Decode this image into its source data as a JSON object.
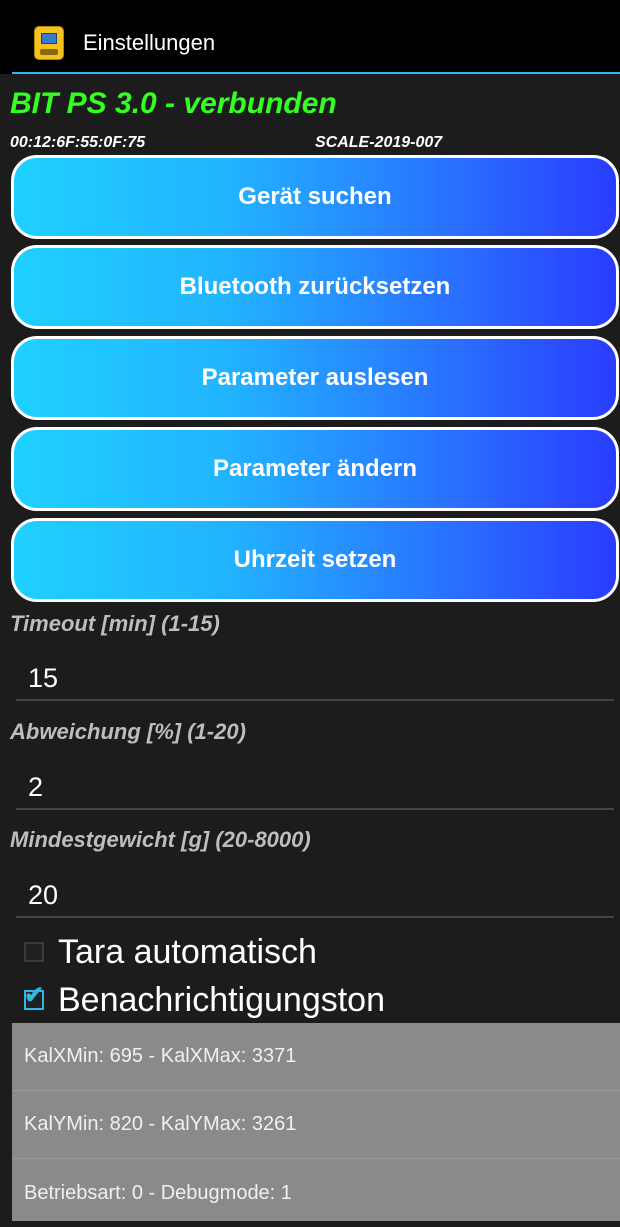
{
  "titlebar": {
    "title": "Einstellungen",
    "icon": "scale-app-icon"
  },
  "status": {
    "connection": "BIT PS 3.0 - verbunden",
    "mac_address": "00:12:6F:55:0F:75",
    "device_id": "SCALE-2019-007"
  },
  "buttons": {
    "search": "Gerät suchen",
    "reset_bluetooth": "Bluetooth zurücksetzen",
    "read_params": "Parameter auslesen",
    "change_params": "Parameter ändern",
    "set_time": "Uhrzeit setzen"
  },
  "fields": {
    "timeout": {
      "label": "Timeout [min] (1-15)",
      "value": "15"
    },
    "deviation": {
      "label": "Abweichung [%] (1-20)",
      "value": "2"
    },
    "min_weight": {
      "label": "Mindestgewicht [g] (20-8000)",
      "value": "20"
    }
  },
  "checkboxes": {
    "tare_auto": {
      "label": "Tara automatisch",
      "checked": false
    },
    "notify_tone": {
      "label": "Benachrichtigungston",
      "checked": true
    }
  },
  "info": {
    "row1": "KalXMin: 695 - KalXMax: 3371",
    "row2": "KalYMin: 820 - KalYMax: 3261",
    "row3": "Betriebsart: 0 - Debugmode: 1"
  },
  "colors": {
    "status_green": "#33ff22",
    "accent": "#33b5e5",
    "button_gradient_start": "#1fd0ff",
    "button_gradient_end": "#2a3cff"
  }
}
